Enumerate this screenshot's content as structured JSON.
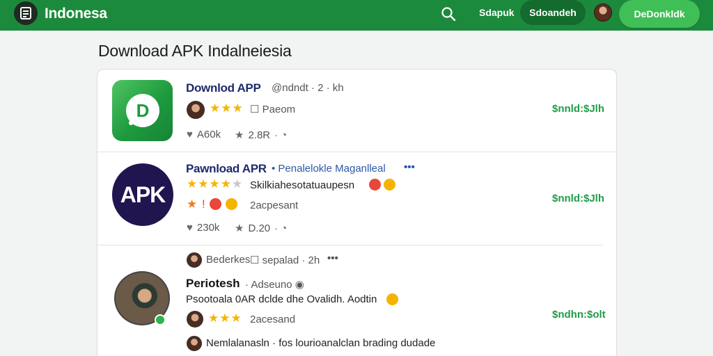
{
  "header": {
    "brand": "Indonesa",
    "nav_link": "Sdapuk",
    "nav_pill": "Sdoandeh",
    "cta": "DeDonkldk"
  },
  "page": {
    "title": "Download APK Indalneiesia"
  },
  "items": [
    {
      "title": "Downlod APP",
      "meta": "@ndndt · 2 · kh",
      "rating_stars": 3,
      "rating_label": "Paeom",
      "price": "$nnld:$Jlh",
      "likes": "A60k",
      "shares": "2.8R"
    },
    {
      "icon_text": "APK",
      "title": "Pawnload APR",
      "meta": "Penalelokle Maganlleal",
      "description": "Skilkiahesotatuaupesn",
      "rating_stars": 4,
      "rating_label": "2acpesant",
      "price": "$nnld:$Jlh",
      "likes": "230k",
      "shares": "D.20"
    },
    {
      "author": "Bederkes",
      "meta": "sepalad · 2h",
      "title": "Periotesh",
      "subtitle": "Adseuno",
      "description": "Psootoala 0AR dclde dhe Ovalidh. Aodtin",
      "rating_stars": 3,
      "rating_label": "2acesand",
      "price": "$ndhn:$olt",
      "footer": "Nemlalanasln · fos lourioanalclan brading dudade"
    }
  ],
  "colors": {
    "brand_green": "#1c8a3c",
    "price_green": "#1f9d48",
    "link_blue": "#2b58a8"
  }
}
